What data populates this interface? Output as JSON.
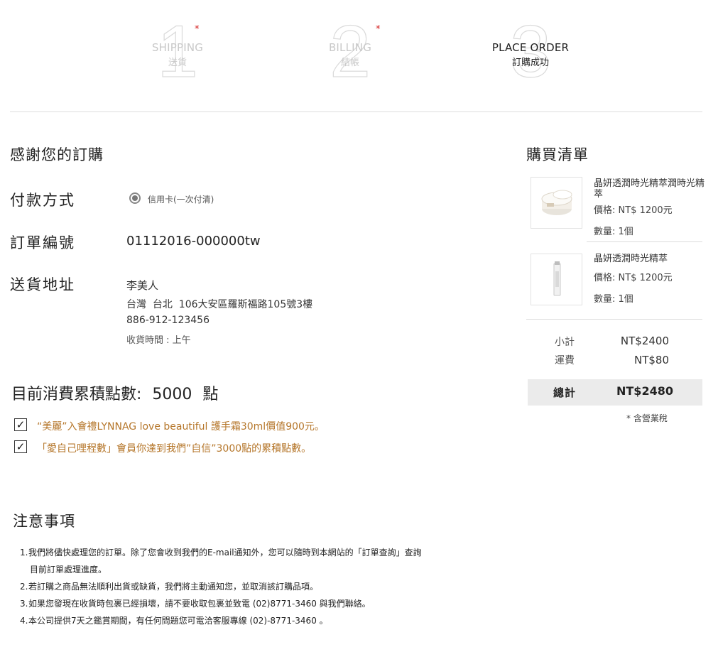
{
  "steps": [
    {
      "num": "1",
      "en": "SHIPPING",
      "zh": "送貨",
      "required": "*"
    },
    {
      "num": "2",
      "en": "BILLING",
      "zh": "結帳",
      "required": "*"
    },
    {
      "num": "3",
      "en": "PLACE ORDER",
      "zh": "訂購成功"
    }
  ],
  "main": {
    "thanks": "感謝您的訂購",
    "payment_label": "付款方式",
    "payment_option": "信用卡(一次付清)",
    "order_no_label": "訂單編號",
    "order_no": "01112016-000000tw",
    "address_label": "送貨地址",
    "name": "李美人",
    "address": "台灣  台北  106大安區羅斯福路105號3樓",
    "phone": "886-912-123456",
    "delivery_time": "收貨時間 : 上午",
    "points_label": "目前消費累積點數:",
    "points_value": "5000",
    "points_unit": "點",
    "gifts": [
      "“美麗”入會禮LYNNAG love beautiful 護手霜30ml價值900元。",
      "「愛自己哩程數」會員你達到我們”自信”3000點的累積點數。"
    ],
    "check_glyph": "✓"
  },
  "notes": {
    "title": "注意事項",
    "items": [
      {
        "idx": "1.",
        "text": "我們將儘快處理您的訂單。除了您會收到我們的E-mail通知外，您可以隨時到本網站的「訂單查詢」查詢",
        "cont": "目前訂單處理進度。"
      },
      {
        "idx": "2.",
        "text": "若訂購之商品無法順利出貨或缺貨，我們將主動通知您，並取消該訂購品項。"
      },
      {
        "idx": "3.",
        "text": "如果您發現在收貨時包裹已經損壞，請不要收取包裹並致電 (02)8771-3460 與我們聯絡。"
      },
      {
        "idx": "4.",
        "text": "本公司提供7天之鑑賞期間，有任何問題您可電洽客服專線 (02)-8771-3460 。"
      }
    ]
  },
  "cart": {
    "title": "購買清單",
    "items": [
      {
        "name": "晶妍透潤時光精萃潤時光精萃",
        "price": "價格: NT$ 1200元",
        "qty": "數量: 1個"
      },
      {
        "name": "晶妍透潤時光精萃",
        "price": "價格: NT$ 1200元",
        "qty": "數量: 1個"
      }
    ],
    "subtotal_label": "小計",
    "subtotal": "NT$2400",
    "shipping_label": "運費",
    "shipping": "NT$80",
    "total_label": "總計",
    "total": "NT$2480",
    "tax_note": "* 含營業稅"
  },
  "colors": {
    "accent": "#b5762a",
    "required": "#d42020",
    "total_bg": "#ebebeb"
  }
}
